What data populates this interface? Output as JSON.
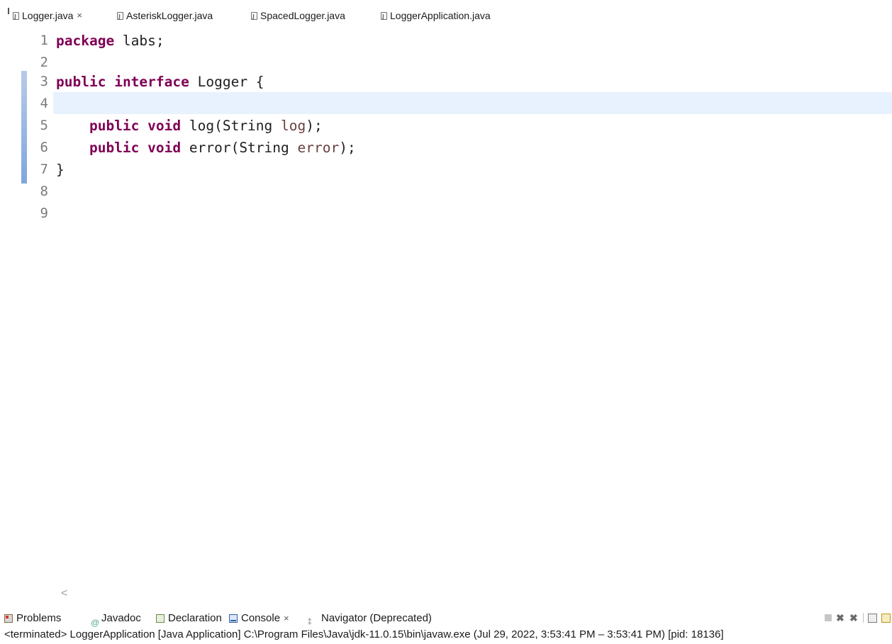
{
  "editor_tabs": [
    {
      "label": "Logger.java",
      "active": true,
      "close": "×"
    },
    {
      "label": "AsteriskLogger.java",
      "active": false
    },
    {
      "label": "SpacedLogger.java",
      "active": false
    },
    {
      "label": "LoggerApplication.java",
      "active": false
    }
  ],
  "editor": {
    "line_numbers": [
      "1",
      "2",
      "3",
      "4",
      "5",
      "6",
      "7",
      "8",
      "9"
    ],
    "current_line": 4,
    "code": {
      "l1_kw": "package",
      "l1_rest": " labs;",
      "l3_kw1": "public",
      "l3_kw2": "interface",
      "l3_rest": " Logger {",
      "l5_indent": "    ",
      "l5_kw1": "public",
      "l5_kw2": "void",
      "l5_rest1": " log(String ",
      "l5_param": "log",
      "l5_rest2": ");",
      "l6_indent": "    ",
      "l6_kw1": "public",
      "l6_kw2": "void",
      "l6_rest1": " error(String ",
      "l6_param": "error",
      "l6_rest2": ");",
      "l7": "}"
    },
    "scroll_left_arrow": "<"
  },
  "bottom_views": [
    {
      "label": "Problems",
      "icon": "problems-icon"
    },
    {
      "label": "Javadoc",
      "icon": "javadoc-icon",
      "glyph": "@"
    },
    {
      "label": "Declaration",
      "icon": "declaration-icon"
    },
    {
      "label": "Console",
      "icon": "console-icon",
      "active": true,
      "close": "×"
    },
    {
      "label": "Navigator (Deprecated)",
      "icon": "navigator-icon",
      "glyph": "⁑"
    }
  ],
  "console": {
    "status": "<terminated> LoggerApplication [Java Application] C:\\Program Files\\Java\\jdk-11.0.15\\bin\\javaw.exe  (Jul 29, 2022, 3:53:41 PM – 3:53:41 PM) [pid: 18136]"
  },
  "colors": {
    "keyword": "#7f0055",
    "parameter": "#6a3e3e",
    "current_line": "#e8f2fe",
    "line_number": "#7a7a7a"
  }
}
